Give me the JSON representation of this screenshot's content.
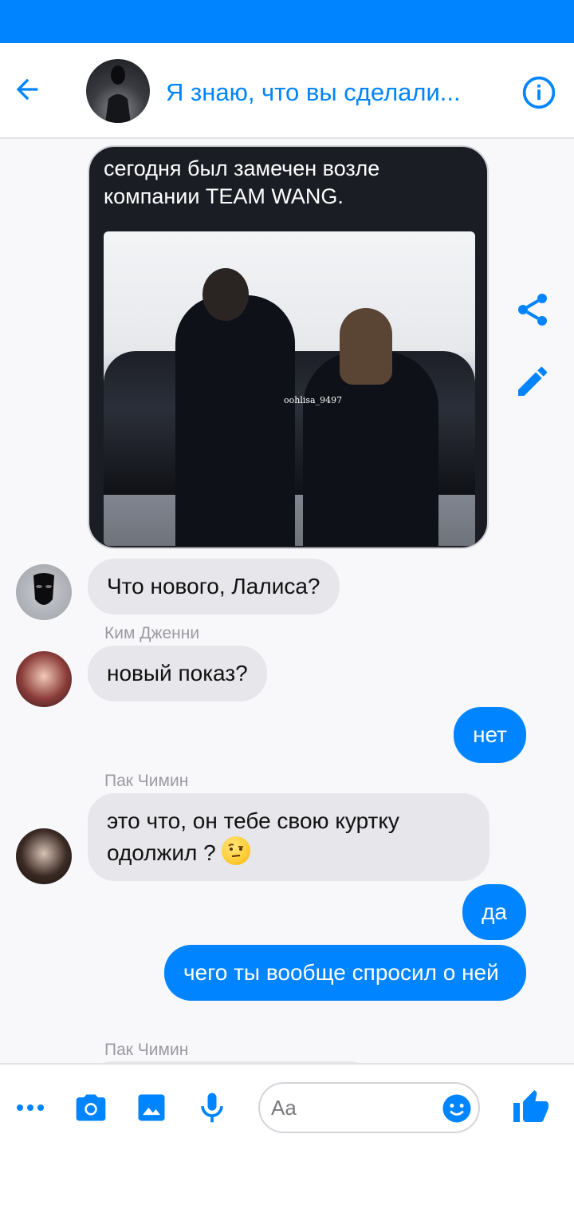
{
  "header": {
    "title": "Я знаю, что вы сделали..."
  },
  "image_message": {
    "caption": "сегодня был замечен возле компании TEAM WANG.",
    "watermark": "oohlisa_9497"
  },
  "messages": [
    {
      "id": "m1",
      "direction": "incoming",
      "sender": "",
      "text": "Что нового, Лалиса?"
    },
    {
      "id": "m2",
      "direction": "incoming",
      "sender": "Ким Дженни",
      "text": "новый показ?"
    },
    {
      "id": "m3",
      "direction": "outgoing",
      "sender": "",
      "text": "нет"
    },
    {
      "id": "m4",
      "direction": "incoming",
      "sender": "Пак Чимин",
      "text": "это что, он тебе свою куртку одолжил ?",
      "emoji": "face-with-raised-eyebrow"
    },
    {
      "id": "m5",
      "direction": "outgoing",
      "sender": "",
      "text": "да"
    },
    {
      "id": "m6",
      "direction": "outgoing",
      "sender": "",
      "text": "чего ты вообще спросил о ней"
    },
    {
      "id": "m7",
      "direction": "incoming",
      "sender": "Пак Чимин",
      "text": ""
    }
  ],
  "composer": {
    "placeholder": "Aa"
  },
  "colors": {
    "accent": "#0084ff",
    "incoming_bubble": "#e6e6eb",
    "sender_label": "#9a9aa2"
  }
}
